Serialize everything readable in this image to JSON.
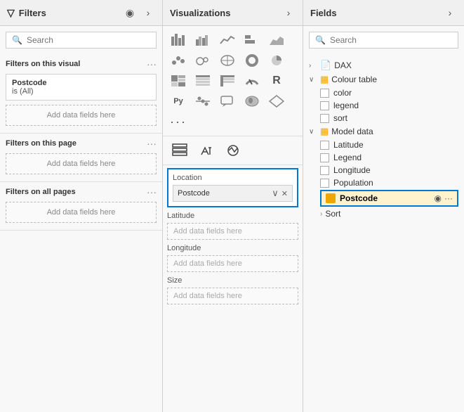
{
  "filters_panel": {
    "title": "Filters",
    "search_placeholder": "Search",
    "sections": {
      "visual": {
        "label": "Filters on this visual",
        "card": {
          "title": "Postcode",
          "value": "is (All)"
        },
        "add_placeholder": "Add data fields here"
      },
      "page": {
        "label": "Filters on this page",
        "add_placeholder": "Add data fields here"
      },
      "all_pages": {
        "label": "Filters on all pages",
        "add_placeholder": "Add data fields here"
      }
    }
  },
  "visualizations_panel": {
    "title": "Visualizations",
    "icons": [
      "▦",
      "▬",
      "📈",
      "📊",
      "⬛",
      "〰",
      "☁",
      "🗺",
      "🍩",
      "⚙",
      "📉",
      "🅰",
      "🎯",
      "📋",
      "🧮",
      "📌",
      "Py",
      "🔢",
      "💬",
      "🖼",
      "◆",
      "…"
    ],
    "toolbar": {
      "fields_icon": "⊞",
      "format_icon": "🖌",
      "analytics_icon": "📐"
    },
    "field_groups": {
      "location": {
        "label": "Location",
        "chip": "Postcode",
        "highlighted": true
      },
      "latitude": {
        "label": "Latitude",
        "add_placeholder": "Add data fields here"
      },
      "longitude": {
        "label": "Longitude",
        "add_placeholder": "Add data fields here"
      },
      "size": {
        "label": "Size",
        "add_placeholder": "Add data fields here"
      }
    }
  },
  "fields_panel": {
    "title": "Fields",
    "search_placeholder": "Search",
    "tree": {
      "dax": {
        "label": "DAX",
        "expanded": false
      },
      "colour_table": {
        "label": "Colour table",
        "expanded": true,
        "fields": [
          "color",
          "legend",
          "sort"
        ]
      },
      "model_data": {
        "label": "Model data",
        "expanded": true,
        "fields": [
          "Latitude",
          "Legend",
          "Longitude",
          "Population"
        ]
      },
      "postcode": {
        "label": "Postcode",
        "highlighted": true
      },
      "sort": {
        "label": "Sort"
      }
    }
  },
  "icons": {
    "funnel": "▽",
    "eye": "👁",
    "chevron_right": "›",
    "chevron_down": "∨",
    "search": "🔍",
    "dots": "···",
    "close": "✕",
    "expand": "›"
  }
}
